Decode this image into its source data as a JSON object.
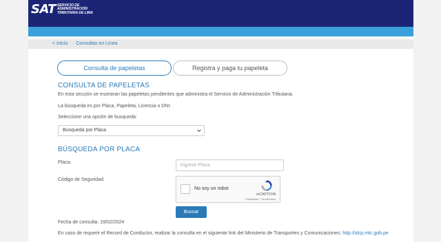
{
  "header": {
    "logo_main": "SAT",
    "logo_line1": "SERVICIO DE",
    "logo_line2": "ADMINISTRACIÓN",
    "logo_line3": "TRIBUTARIA DE LIMA"
  },
  "breadcrumb": {
    "home": "< Inicio",
    "current": "Consultas en Línea"
  },
  "tabs": [
    {
      "label": "Consulta de papeletas",
      "active": true
    },
    {
      "label": "Registra y paga tu papeleta",
      "active": false
    }
  ],
  "section1": {
    "title": "CONSULTA DE PAPELETAS",
    "text1": "En esta sección se muestran las papeletas pendientes que administra el Servicio de Administración Tributaria.",
    "text2": "La búsqueda es por Placa, Papeleta, Licencia o DNI.",
    "select_prompt": "Seleccione una opción de busqueda:",
    "select_value": "Busqueda por Placa"
  },
  "section2": {
    "title": "BÚSQUEDA POR PLACA",
    "placa_label": "Placa:",
    "placa_placeholder": "Ingrese Placa",
    "security_label": "Código de Seguridad:",
    "captcha_label": "No soy un robot",
    "captcha_brand": "reCAPTCHA",
    "captcha_links": "Privacidad - Condiciones",
    "search_button": "Buscar",
    "date_label": "Fecha de consulta:",
    "date_value": "19/02/2024",
    "footer_text": "En caso de requerir el Record de Conductor, realizar la consulta en el siguiente link del Ministerio de Transportes y Comunicaciones:",
    "footer_link": "http://slcp.mtc.gob.pe"
  },
  "colors": {
    "header_bg": "#1c2575",
    "accent_bar": "#3aa0dc",
    "primary": "#2a7ab8"
  }
}
